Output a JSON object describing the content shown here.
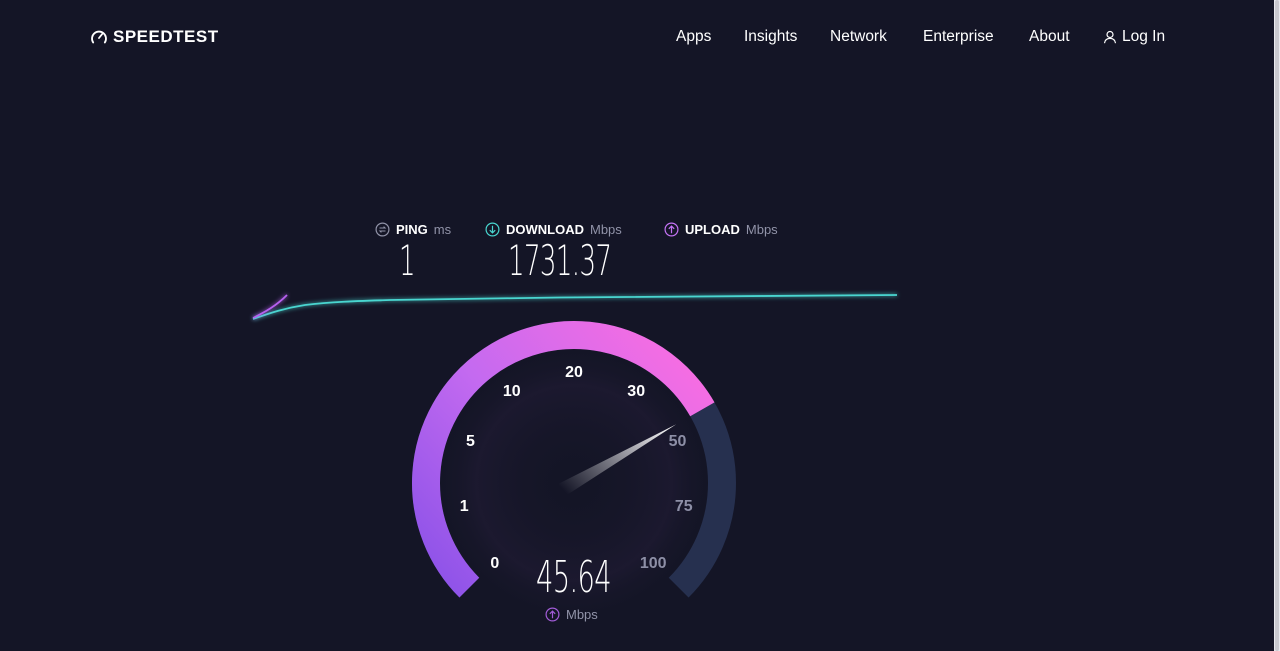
{
  "brand": {
    "logo_text": "SPEEDTEST",
    "logo_icon": "gauge-icon"
  },
  "nav": {
    "items": [
      {
        "label": "Apps"
      },
      {
        "label": "Insights"
      },
      {
        "label": "Network"
      },
      {
        "label": "Enterprise"
      },
      {
        "label": "About"
      }
    ],
    "login": {
      "label": "Log In",
      "icon": "user-icon"
    }
  },
  "results": {
    "ping": {
      "label": "PING",
      "unit": "ms",
      "value": "1",
      "icon": "ping-icon"
    },
    "download": {
      "label": "DOWNLOAD",
      "unit": "Mbps",
      "value": "1731.37",
      "icon": "download-arrow-icon"
    },
    "upload": {
      "label": "UPLOAD",
      "unit": "Mbps",
      "icon": "upload-arrow-icon"
    }
  },
  "gauge": {
    "current_value": "45.64",
    "unit": "Mbps",
    "unit_icon": "upload-arrow-icon",
    "scale_labels": [
      "0",
      "1",
      "5",
      "10",
      "20",
      "30",
      "50",
      "75",
      "100"
    ],
    "fill_to_label_value": 45.64,
    "colors": {
      "fill_start": "#8c52e8",
      "fill_end": "#ff6ee0",
      "track": "#26304f",
      "download_line": "#49d6d0",
      "upload_line": "#b760f0"
    }
  }
}
